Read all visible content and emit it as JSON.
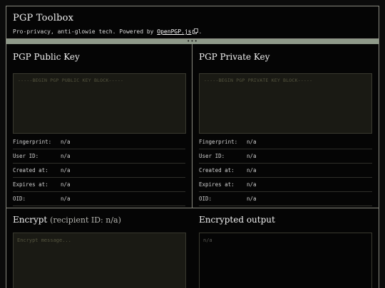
{
  "app": {
    "title": "PGP Toolbox",
    "tagline_prefix": "Pro-privacy, anti-glowie tech. Powered by ",
    "tagline_link": "OpenPGP.js",
    "tagline_suffix": "."
  },
  "public_key": {
    "title": "PGP Public Key",
    "placeholder": "-----BEGIN PGP PUBLIC KEY BLOCK-----",
    "fields": [
      {
        "label": "Fingerprint:",
        "value": "n/a"
      },
      {
        "label": "User ID:",
        "value": "n/a"
      },
      {
        "label": "Created at:",
        "value": "n/a"
      },
      {
        "label": "Expires at:",
        "value": "n/a"
      },
      {
        "label": "OID:",
        "value": "n/a"
      }
    ]
  },
  "private_key": {
    "title": "PGP Private Key",
    "placeholder": "-----BEGIN PGP PRIVATE KEY BLOCK-----",
    "fields": [
      {
        "label": "Fingerprint:",
        "value": "n/a"
      },
      {
        "label": "User ID:",
        "value": "n/a"
      },
      {
        "label": "Created at:",
        "value": "n/a"
      },
      {
        "label": "Expires at:",
        "value": "n/a"
      },
      {
        "label": "OID:",
        "value": "n/a"
      }
    ]
  },
  "encrypt": {
    "title": "Encrypt",
    "recipient": "(recipient ID: n/a)",
    "placeholder": "Encrypt message..."
  },
  "output": {
    "title": "Encrypted output",
    "value": "n/a"
  },
  "divider": {
    "dots": "•••"
  },
  "icons": {
    "external_link": "external-link-icon"
  }
}
